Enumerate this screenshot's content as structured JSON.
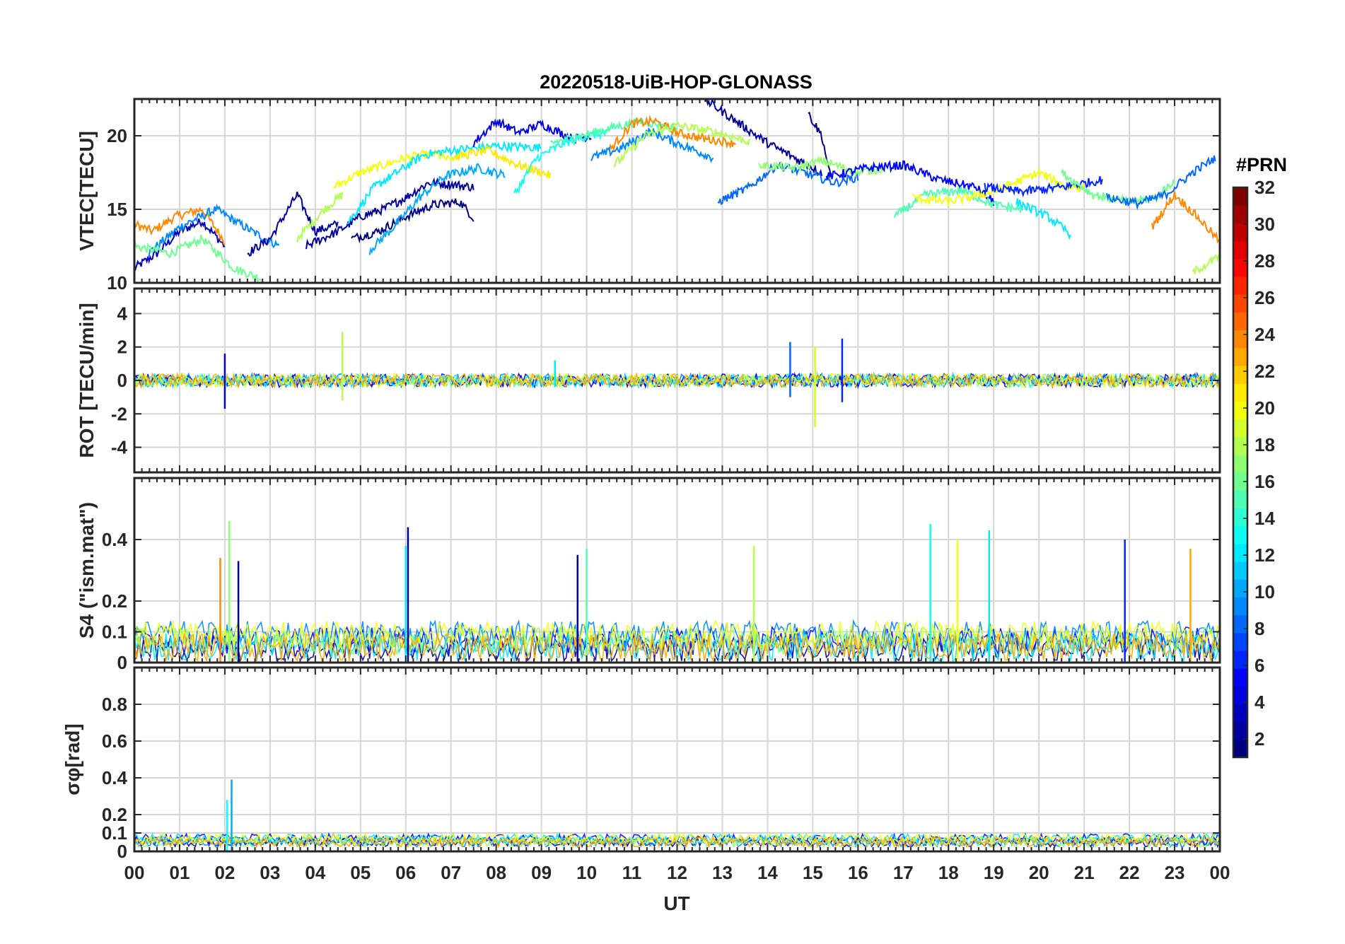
{
  "chart_data": [
    {
      "type": "line",
      "title": "20220518-UiB-HOP-GLONASS",
      "xlabel": "",
      "ylabel": "VTEC[TECU]",
      "ylim": [
        10,
        22.5
      ],
      "yticks": [
        10,
        15,
        20
      ],
      "grid": true,
      "series_color_by": "PRN (colormap jet, 1-32)",
      "series": [
        {
          "prn": 3,
          "x": [
            0.0,
            0.5,
            1.0,
            1.5,
            2.0
          ],
          "y": [
            11,
            12,
            13.5,
            14.2,
            12.5
          ]
        },
        {
          "prn": 24,
          "x": [
            0.0,
            0.4,
            0.9,
            1.5,
            2.0
          ],
          "y": [
            14,
            13.5,
            14.5,
            15,
            12.8
          ]
        },
        {
          "prn": 9,
          "x": [
            0.3,
            1.0,
            1.8,
            2.6,
            3.2
          ],
          "y": [
            12,
            13.8,
            15,
            13.5,
            12.5
          ]
        },
        {
          "prn": 16,
          "x": [
            0.0,
            0.8,
            1.5,
            2.2,
            2.8
          ],
          "y": [
            12.5,
            12,
            13,
            11,
            10.3
          ]
        },
        {
          "prn": 2,
          "x": [
            2.5,
            3.0,
            3.6,
            4.0,
            4.5
          ],
          "y": [
            12,
            13,
            16,
            13.5,
            14
          ]
        },
        {
          "prn": 18,
          "x": [
            3.6,
            4.2,
            4.6
          ],
          "y": [
            13,
            15,
            16
          ]
        },
        {
          "prn": 20,
          "x": [
            4.4,
            5.0,
            5.5,
            6.0,
            6.6,
            7.0
          ],
          "y": [
            16.5,
            17.5,
            18,
            18.5,
            18.8,
            18.3
          ]
        },
        {
          "prn": 2,
          "x": [
            3.8,
            4.5,
            5.0,
            5.5,
            6.0,
            6.5,
            7.0,
            7.5
          ],
          "y": [
            12.5,
            13.5,
            14.5,
            15,
            15.8,
            16.8,
            16.7,
            16.5
          ]
        },
        {
          "prn": 1,
          "x": [
            4.8,
            5.4,
            6.0,
            6.6,
            7.2,
            7.5
          ],
          "y": [
            13,
            13.5,
            14.5,
            15.3,
            15.5,
            14.4
          ]
        },
        {
          "prn": 12,
          "x": [
            4.7,
            5.3,
            5.8,
            6.4,
            7.0,
            8.0,
            9.0
          ],
          "y": [
            14,
            16.5,
            17.5,
            18.7,
            19,
            19.3,
            19.2
          ]
        },
        {
          "prn": 10,
          "x": [
            5.2,
            5.8,
            6.3,
            6.9,
            7.6,
            8.2
          ],
          "y": [
            12.2,
            14,
            15.8,
            17.3,
            17.8,
            17.3
          ]
        },
        {
          "prn": 4,
          "x": [
            7.5,
            8.0,
            8.5,
            9.0,
            9.7,
            10.1
          ],
          "y": [
            19.5,
            21,
            20.2,
            20.8,
            19.8,
            20
          ]
        },
        {
          "prn": 21,
          "x": [
            7.0,
            7.8,
            8.5,
            9.2
          ],
          "y": [
            18.5,
            19,
            18,
            17.3
          ]
        },
        {
          "prn": 13,
          "x": [
            8.4,
            8.9,
            9.5,
            10.0,
            10.5
          ],
          "y": [
            16,
            18.5,
            19.5,
            20,
            20.2
          ]
        },
        {
          "prn": 15,
          "x": [
            9.2,
            9.9,
            10.5,
            11.2,
            12.0
          ],
          "y": [
            19.5,
            20,
            20.5,
            21,
            20.5
          ]
        },
        {
          "prn": 24,
          "x": [
            10.5,
            11.0,
            11.5,
            12.0,
            12.6,
            13.3
          ],
          "y": [
            19,
            20.8,
            21,
            20.2,
            19.8,
            19.5
          ]
        },
        {
          "prn": 9,
          "x": [
            10.1,
            10.8,
            11.4,
            12.0,
            12.8
          ],
          "y": [
            18.5,
            19.2,
            20.3,
            19.5,
            18.5
          ]
        },
        {
          "prn": 18,
          "x": [
            10.6,
            11.3,
            12.0,
            12.9,
            13.6
          ],
          "y": [
            18,
            20,
            20.7,
            20.2,
            19.6
          ]
        },
        {
          "prn": 2,
          "x": [
            12.6,
            13.3,
            14.0,
            14.6,
            15.2
          ],
          "y": [
            22.5,
            21,
            19.5,
            18.5,
            17.5
          ]
        },
        {
          "prn": 1,
          "x": [
            14.9,
            15.2,
            15.4
          ],
          "y": [
            21.5,
            20,
            17
          ]
        },
        {
          "prn": 8,
          "x": [
            12.9,
            13.6,
            14.2,
            14.8,
            15.5,
            16.0
          ],
          "y": [
            15.5,
            16.5,
            18,
            17.5,
            16.8,
            17.2
          ]
        },
        {
          "prn": 17,
          "x": [
            13.8,
            14.6,
            15.2,
            16.0,
            16.6
          ],
          "y": [
            18,
            17.8,
            18.3,
            17.5,
            17.8
          ]
        },
        {
          "prn": 5,
          "x": [
            15.3,
            16.2,
            17.0,
            17.8,
            18.6,
            19.0
          ],
          "y": [
            17.2,
            17.8,
            18,
            17,
            16.5,
            15.5
          ]
        },
        {
          "prn": 15,
          "x": [
            16.8,
            17.5,
            18.3,
            19.0,
            19.6
          ],
          "y": [
            14.5,
            16,
            16.3,
            15.3,
            15
          ]
        },
        {
          "prn": 20,
          "x": [
            17.2,
            18.0,
            19.0,
            20.0,
            20.6,
            21.0
          ],
          "y": [
            15.8,
            15.5,
            16.2,
            17.5,
            16.5,
            16.5
          ]
        },
        {
          "prn": 12,
          "x": [
            19.5,
            20.2,
            20.7
          ],
          "y": [
            15.5,
            14.5,
            13.3
          ]
        },
        {
          "prn": 6,
          "x": [
            18.8,
            19.6,
            20.5,
            21.4
          ],
          "y": [
            16.5,
            16.2,
            16.5,
            17
          ]
        },
        {
          "prn": 16,
          "x": [
            20.5,
            21.2,
            22.0,
            22.6,
            23.0
          ],
          "y": [
            17.5,
            16,
            15.5,
            15.8,
            17
          ]
        },
        {
          "prn": 8,
          "x": [
            21.5,
            22.2,
            22.8,
            23.4,
            23.9
          ],
          "y": [
            15.8,
            15.4,
            16,
            17.5,
            18.5
          ]
        },
        {
          "prn": 24,
          "x": [
            22.5,
            23.0,
            23.5,
            24.0
          ],
          "y": [
            13.8,
            16,
            14.5,
            12.8
          ]
        },
        {
          "prn": 18,
          "x": [
            23.4,
            24.0
          ],
          "y": [
            10.7,
            11.8
          ]
        }
      ]
    },
    {
      "type": "line",
      "xlabel": "",
      "ylabel": "ROT [TECU/min]",
      "ylim": [
        -5.5,
        5.5
      ],
      "yticks": [
        -4,
        -2,
        0,
        2,
        4
      ],
      "grid": true,
      "series_color_by": "PRN (colormap jet, 1-32)",
      "spikes": [
        {
          "prn": 18,
          "x": 4.6,
          "ymin": -1.2,
          "ymax": 2.9
        },
        {
          "prn": 8,
          "x": 14.5,
          "ymin": -1.0,
          "ymax": 2.3
        },
        {
          "prn": 19,
          "x": 15.05,
          "ymin": -2.8,
          "ymax": 2.0
        },
        {
          "prn": 6,
          "x": 15.65,
          "ymin": -1.3,
          "ymax": 2.5
        },
        {
          "prn": 4,
          "x": 2.0,
          "ymin": -1.7,
          "ymax": 1.6
        },
        {
          "prn": 12,
          "x": 9.3,
          "ymin": -0.4,
          "ymax": 1.2
        }
      ]
    },
    {
      "type": "line",
      "xlabel": "",
      "ylabel": "S4 (\"ism.mat\")",
      "ylim": [
        0,
        0.6
      ],
      "yticks": [
        0,
        0.1,
        0.2,
        0.4
      ],
      "grid": true,
      "series_color_by": "PRN (colormap jet, 1-32)",
      "spikes": [
        {
          "prn": 24,
          "x": 1.9,
          "ymax": 0.34
        },
        {
          "prn": 17,
          "x": 2.1,
          "ymax": 0.46
        },
        {
          "prn": 1,
          "x": 2.3,
          "ymax": 0.33
        },
        {
          "prn": 1,
          "x": 6.05,
          "ymax": 0.44
        },
        {
          "prn": 12,
          "x": 6.0,
          "ymax": 0.38
        },
        {
          "prn": 2,
          "x": 9.8,
          "ymax": 0.35
        },
        {
          "prn": 15,
          "x": 10.0,
          "ymax": 0.37
        },
        {
          "prn": 18,
          "x": 13.7,
          "ymax": 0.38
        },
        {
          "prn": 13,
          "x": 17.6,
          "ymax": 0.45
        },
        {
          "prn": 20,
          "x": 18.2,
          "ymax": 0.4
        },
        {
          "prn": 12,
          "x": 18.9,
          "ymax": 0.43
        },
        {
          "prn": 6,
          "x": 21.9,
          "ymax": 0.4
        },
        {
          "prn": 23,
          "x": 23.35,
          "ymax": 0.37
        }
      ]
    },
    {
      "type": "line",
      "xlabel": "UT",
      "ylabel": "σφ[rad]",
      "ylim": [
        0,
        1
      ],
      "yticks": [
        0,
        0.1,
        0.2,
        0.4,
        0.6,
        0.8
      ],
      "xticks": [
        "00",
        "01",
        "02",
        "03",
        "04",
        "05",
        "06",
        "07",
        "08",
        "09",
        "10",
        "11",
        "12",
        "13",
        "14",
        "15",
        "16",
        "17",
        "18",
        "19",
        "20",
        "21",
        "22",
        "23",
        "00"
      ],
      "grid": true,
      "series_color_by": "PRN (colormap jet, 1-32)",
      "spikes": [
        {
          "prn": 10,
          "x": 2.15,
          "ymax": 0.39
        },
        {
          "prn": 13,
          "x": 2.05,
          "ymax": 0.28
        }
      ]
    }
  ],
  "colorbar": {
    "title": "#PRN",
    "colormap": "jet",
    "range": [
      1,
      32
    ],
    "ticks": [
      2,
      4,
      6,
      8,
      10,
      12,
      14,
      16,
      18,
      20,
      22,
      24,
      26,
      28,
      30,
      32
    ]
  }
}
